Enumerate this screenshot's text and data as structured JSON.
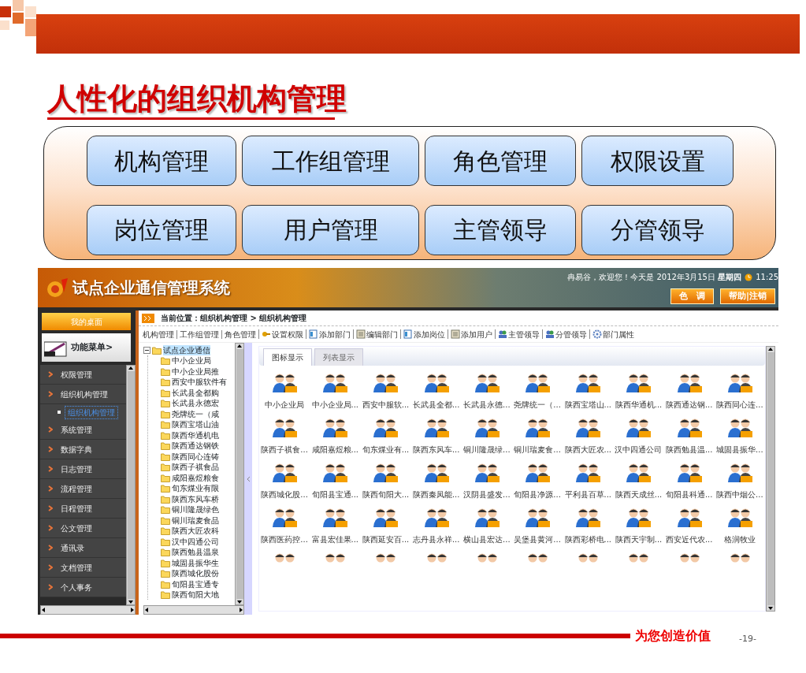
{
  "slide": {
    "title": "人性化的组织机构管理",
    "features": [
      "机构管理",
      "工作组管理",
      "角色管理",
      "权限设置",
      "岗位管理",
      "用户管理",
      "主管领导",
      "分管领导"
    ],
    "tagline": "为您创造价值",
    "page_number": "-19-"
  },
  "app": {
    "title": "试点企业通信管理系统",
    "welcome": "冉易谷，欢迎您！今天是 2012年3月15日 **星期四**",
    "time": "11:25",
    "header_buttons": [
      "色　调",
      "帮助|注销"
    ],
    "desk_button": "我的桌面",
    "menu_label": "功能菜单>",
    "menu": [
      {
        "label": "权限管理"
      },
      {
        "label": "组织机构管理",
        "children": [
          {
            "label": "组织机构管理",
            "selected": true
          }
        ]
      },
      {
        "label": "系统管理"
      },
      {
        "label": "数据字典"
      },
      {
        "label": "日志管理"
      },
      {
        "label": "流程管理"
      },
      {
        "label": "日程管理"
      },
      {
        "label": "公文管理"
      },
      {
        "label": "通讯录"
      },
      {
        "label": "文档管理"
      },
      {
        "label": "个人事务"
      }
    ],
    "breadcrumb": "当前位置：组织机构管理 > 组织机构管理",
    "toolbar": [
      {
        "label": "机构管理",
        "kind": "plain"
      },
      {
        "label": "工作组管理",
        "kind": "plain"
      },
      {
        "label": "角色管理",
        "kind": "plain"
      },
      {
        "label": "设置权限",
        "kind": "key"
      },
      {
        "label": "添加部门",
        "kind": "doc"
      },
      {
        "label": "编辑部门",
        "kind": "edit"
      },
      {
        "label": "添加岗位",
        "kind": "doc"
      },
      {
        "label": "添加用户",
        "kind": "edit"
      },
      {
        "label": "主管领导",
        "kind": "people"
      },
      {
        "label": "分管领导",
        "kind": "people"
      },
      {
        "label": "部门属性",
        "kind": "gear"
      }
    ],
    "tree": {
      "label": "试点企业通信",
      "expanded": true,
      "selected": true,
      "children": [
        {
          "label": "中小企业局"
        },
        {
          "label": "中小企业局推"
        },
        {
          "label": "西安中服软件有"
        },
        {
          "label": "长武县全都购"
        },
        {
          "label": "长武县永德宏"
        },
        {
          "label": "尧牌统一（咸"
        },
        {
          "label": "陕西宝塔山油"
        },
        {
          "label": "陕西华通机电"
        },
        {
          "label": "陕西通达钢铁"
        },
        {
          "label": "陕西同心连铸"
        },
        {
          "label": "陕西子祺食品"
        },
        {
          "label": "咸阳嘉煜粮食"
        },
        {
          "label": "旬东煤业有限"
        },
        {
          "label": "陕西东风车桥"
        },
        {
          "label": "铜川隆晟绿色"
        },
        {
          "label": "铜川瑞麦食品"
        },
        {
          "label": "陕西大匠农科"
        },
        {
          "label": "汉中四通公司"
        },
        {
          "label": "陕西勉县温泉"
        },
        {
          "label": "城固县振华生"
        },
        {
          "label": "陕西城化股份"
        },
        {
          "label": "旬阳县宝通专"
        },
        {
          "label": "陕西旬阳大地"
        }
      ]
    },
    "view_tabs": [
      {
        "label": "图标显示",
        "selected": true
      },
      {
        "label": "列表显示",
        "selected": false
      }
    ],
    "grid_rows": [
      [
        "中小企业局",
        "中小企业局...",
        "西安中服软...",
        "长武县全都...",
        "长武县永德...",
        "尧牌统一（...",
        "陕西宝塔山...",
        "陕西华通机...",
        "陕西通达钢...",
        "陕西同心连..."
      ],
      [
        "陕西子祺食...",
        "咸阳嘉煜粮...",
        "旬东煤业有...",
        "陕西东风车...",
        "铜川隆晟绿...",
        "铜川瑞麦食...",
        "陕西大匠农...",
        "汉中四通公司",
        "陕西勉县温...",
        "城固县振华..."
      ],
      [
        "陕西城化股...",
        "旬阳县宝通...",
        "陕西旬阳大...",
        "陕西秦凤能...",
        "汉阴县盛发...",
        "旬阳县净源...",
        "平利县百草...",
        "陕西天成丝...",
        "旬阳县科通...",
        "陕西中烟公..."
      ],
      [
        "陕西医药控...",
        "富县宏佳果...",
        "陕西延安百...",
        "志丹县永祥...",
        "横山县宏达...",
        "吴堡县黄河...",
        "陕西彩桥电...",
        "陕西天宇制...",
        "西安近代农...",
        "格润牧业"
      ]
    ]
  }
}
